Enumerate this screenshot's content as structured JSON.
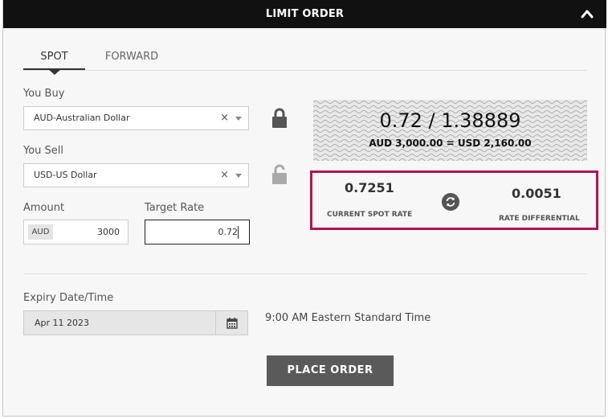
{
  "header": {
    "title": "LIMIT ORDER",
    "collapse_icon": "chevron-up-icon"
  },
  "tabs": [
    {
      "label": "SPOT",
      "active": true
    },
    {
      "label": "FORWARD",
      "active": false
    }
  ],
  "you_buy": {
    "label": "You Buy",
    "value": "AUD-Australian Dollar",
    "clear": "×"
  },
  "you_sell": {
    "label": "You Sell",
    "value": "USD-US Dollar",
    "clear": "×"
  },
  "buy_lock": {
    "icon": "lock-closed-icon"
  },
  "sell_lock": {
    "icon": "lock-open-icon"
  },
  "amount": {
    "label": "Amount",
    "currency": "AUD",
    "value": "3000"
  },
  "target_rate": {
    "label": "Target Rate",
    "value": "0.72"
  },
  "quote": {
    "rate": "0.72 / 1.38889",
    "conversion": "AUD 3,000.00 = USD 2,160.00"
  },
  "spot": {
    "current_value": "0.7251",
    "current_label": "CURRENT SPOT RATE",
    "diff_value": "0.0051",
    "diff_label": "RATE DIFFERENTIAL",
    "refresh_icon": "refresh-icon",
    "highlight_color": "#b0164f"
  },
  "expiry": {
    "label": "Expiry Date/Time",
    "date": "Apr 11 2023",
    "timezone_text": "9:00 AM Eastern Standard Time",
    "calendar_icon": "calendar-icon"
  },
  "place_order": {
    "label": "PLACE ORDER"
  }
}
